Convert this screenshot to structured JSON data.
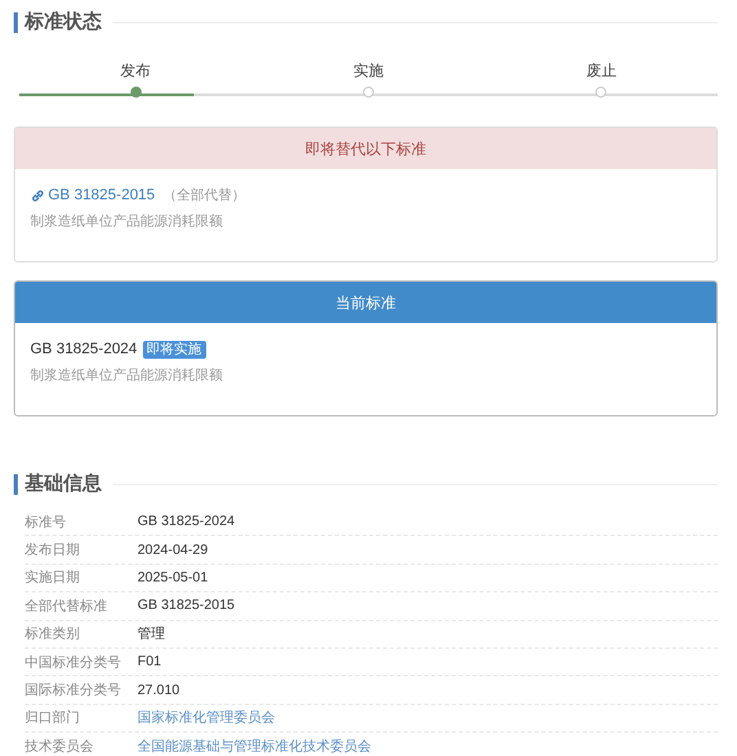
{
  "status_section": {
    "title": "标准状态",
    "steps": [
      {
        "label": "发布",
        "selected": true
      },
      {
        "label": "实施",
        "selected": false
      },
      {
        "label": "废止",
        "selected": false
      }
    ]
  },
  "replaced_card": {
    "header": "即将替代以下标准",
    "code": "GB 31825-2015",
    "note": "（全部代替）",
    "name": "制浆造纸单位产品能源消耗限额"
  },
  "current_card": {
    "header": "当前标准",
    "code": "GB 31825-2024",
    "badge": "即将实施",
    "name": "制浆造纸单位产品能源消耗限额"
  },
  "info_section": {
    "title": "基础信息",
    "rows": [
      {
        "label": "标准号",
        "value": "GB 31825-2024",
        "kind": "text"
      },
      {
        "label": "发布日期",
        "value": "2024-04-29",
        "kind": "text"
      },
      {
        "label": "实施日期",
        "value": "2025-05-01",
        "kind": "text"
      },
      {
        "label": "全部代替标准",
        "value": "GB 31825-2015",
        "kind": "text"
      },
      {
        "label": "标准类别",
        "value": "管理",
        "kind": "text"
      },
      {
        "label": "中国标准分类号",
        "value": "F01",
        "kind": "text"
      },
      {
        "label": "国际标准分类号",
        "value": "27.010",
        "kind": "text"
      },
      {
        "label": "归口部门",
        "value": "国家标准化管理委员会",
        "kind": "link"
      },
      {
        "label": "技术委员会",
        "value": "全国能源基础与管理标准化技术委员会",
        "kind": "link"
      }
    ]
  }
}
